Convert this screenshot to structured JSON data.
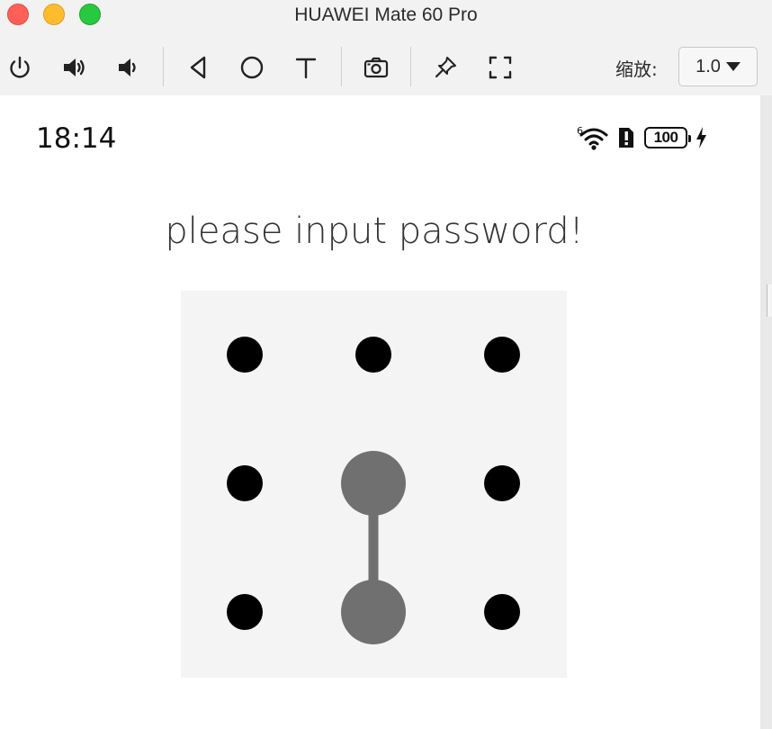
{
  "window": {
    "title": "HUAWEI Mate 60 Pro"
  },
  "toolbar": {
    "buttons": [
      {
        "name": "power-icon"
      },
      {
        "name": "volume-up-icon"
      },
      {
        "name": "volume-down-icon"
      },
      {
        "name": "back-triangle-icon"
      },
      {
        "name": "home-circle-icon"
      },
      {
        "name": "text-input-icon"
      },
      {
        "name": "screenshot-camera-icon"
      },
      {
        "name": "pin-icon"
      },
      {
        "name": "fullscreen-icon"
      }
    ],
    "zoom_label": "缩放:",
    "zoom_value": "1.0"
  },
  "status_bar": {
    "time": "18:14",
    "signal_badge": "6",
    "battery_level": "100"
  },
  "lock_screen": {
    "prompt": "please input password!",
    "grid": {
      "rows": 3,
      "cols": 3
    },
    "selected_dots": [
      4,
      7
    ],
    "colors": {
      "dot_default": "#000000",
      "dot_selected": "#707070",
      "path_line": "#707070",
      "pad_background": "#f4f4f4"
    }
  }
}
